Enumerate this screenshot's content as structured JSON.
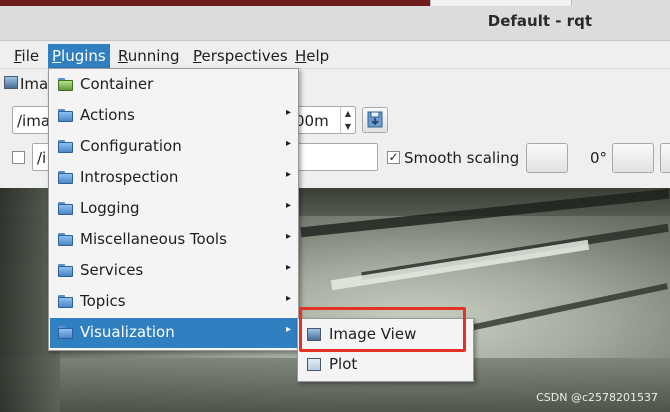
{
  "window": {
    "title": "Default - rqt"
  },
  "menubar": {
    "items": [
      {
        "label": "File",
        "mnemonic": "F",
        "rest": "ile"
      },
      {
        "label": "Plugins",
        "mnemonic": "P",
        "rest": "lugins"
      },
      {
        "label": "Running",
        "mnemonic": "R",
        "rest": "unning"
      },
      {
        "label": "Perspectives",
        "mnemonic": "P",
        "rest": "erspectives"
      },
      {
        "label": "Help",
        "mnemonic": "H",
        "rest": "elp"
      }
    ]
  },
  "plugin_tab": {
    "label_partial": "Imag"
  },
  "toolbar": {
    "topic_combo_partial": "/ima",
    "spin_value_partial": "00m",
    "second_combo_partial": "/i",
    "smooth_scaling_label": "Smooth scaling",
    "smooth_scaling_checked": true,
    "rotation_label": "0°"
  },
  "plugins_menu": {
    "items": [
      {
        "label": "Container",
        "has_submenu": false
      },
      {
        "label": "Actions",
        "has_submenu": true
      },
      {
        "label": "Configuration",
        "has_submenu": true
      },
      {
        "label": "Introspection",
        "has_submenu": true
      },
      {
        "label": "Logging",
        "has_submenu": true
      },
      {
        "label": "Miscellaneous Tools",
        "has_submenu": true
      },
      {
        "label": "Services",
        "has_submenu": true
      },
      {
        "label": "Topics",
        "has_submenu": true
      },
      {
        "label": "Visualization",
        "has_submenu": true,
        "highlighted": true
      }
    ]
  },
  "visualization_submenu": {
    "items": [
      {
        "label": "Image View"
      },
      {
        "label": "Plot"
      }
    ]
  },
  "watermark": "CSDN @c2578201537",
  "colors": {
    "highlight": "#2f7fc1",
    "annotation_box": "#e53127"
  },
  "icons": {
    "arrow": "▸",
    "spin_up": "▲",
    "spin_down": "▼",
    "check": "✓"
  }
}
